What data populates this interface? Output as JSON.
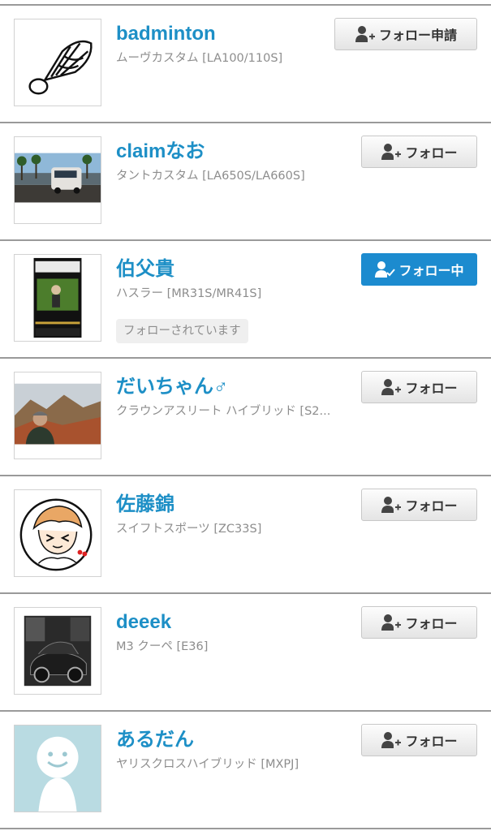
{
  "users": [
    {
      "name": "badminton",
      "car": "ムーヴカスタム [LA100/110S]",
      "button": "フォロー申請",
      "state": "request",
      "badge": ""
    },
    {
      "name": "claimなお",
      "car": "タントカスタム [LA650S/LA660S]",
      "button": "フォロー",
      "state": "follow",
      "badge": ""
    },
    {
      "name": "伯父貴",
      "car": "ハスラー [MR31S/MR41S]",
      "button": "フォロー中",
      "state": "following",
      "badge": "フォローされています"
    },
    {
      "name": "だいちゃん♂",
      "car": "クラウンアスリート ハイブリッド [S2...",
      "button": "フォロー",
      "state": "follow",
      "badge": ""
    },
    {
      "name": "佐藤錦",
      "car": "スイフトスポーツ [ZC33S]",
      "button": "フォロー",
      "state": "follow",
      "badge": ""
    },
    {
      "name": "deeek",
      "car": "M3 クーペ [E36]",
      "button": "フォロー",
      "state": "follow",
      "badge": ""
    },
    {
      "name": "あるだん",
      "car": "ヤリスクロスハイブリッド [MXPJ]",
      "button": "フォロー",
      "state": "follow",
      "badge": ""
    }
  ],
  "icons": {
    "follow": "user-plus-icon",
    "following": "user-check-icon"
  },
  "colors": {
    "name": "#1d8fc6",
    "active_button": "#1c8bcf",
    "divider": "#9a9a9a"
  }
}
